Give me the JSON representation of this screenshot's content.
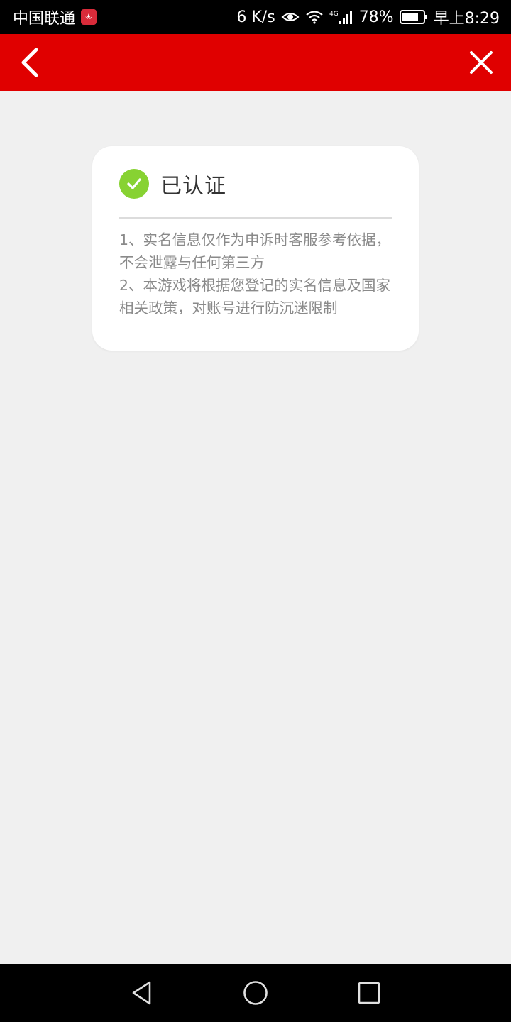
{
  "status_bar": {
    "carrier": "中国联通",
    "net_speed": "6 K/s",
    "network_type": "4G",
    "battery": "78%",
    "time": "早上8:29"
  },
  "nav": {
    "accent_color": "#e00000",
    "back_icon": "chevron-left-icon",
    "close_icon": "close-icon"
  },
  "card": {
    "status_title": "已认证",
    "status_icon": "check-circle-icon",
    "status_color": "#87d232",
    "notice_lines": [
      "1、实名信息仅作为申诉时客服参考依据，不会泄露与任何第三方",
      "2、本游戏将根据您登记的实名信息及国家相关政策，对账号进行防沉迷限制"
    ]
  },
  "system_nav": {
    "buttons": [
      "back-triangle-icon",
      "home-circle-icon",
      "recents-square-icon"
    ]
  }
}
